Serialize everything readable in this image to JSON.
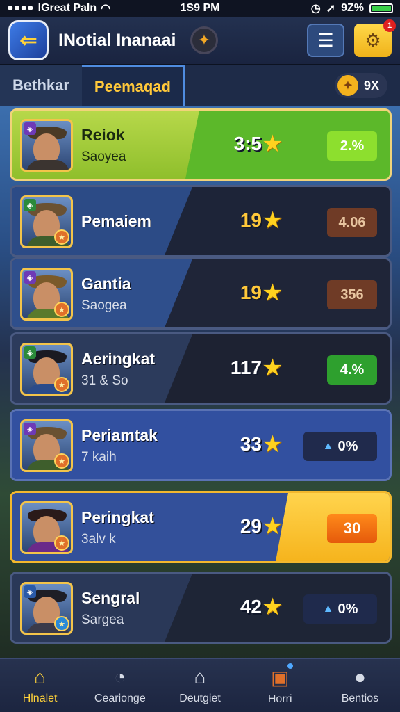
{
  "status_bar": {
    "left_text": "IGreat Paln",
    "time": "1S9 PM",
    "battery": "9Z%",
    "battery_level": 0.92
  },
  "header": {
    "title": "INotial Inanaai"
  },
  "tabs": [
    {
      "label": "Bethkar"
    },
    {
      "label": "Peemaqad"
    }
  ],
  "currency": {
    "label": "9X"
  },
  "leaderboard": [
    {
      "name": "Reiok",
      "sub": "Saoyea",
      "score": "3:5",
      "pct": "2.%"
    },
    {
      "name": "Pemaiem",
      "sub": "",
      "score": "19",
      "pct": "4.06"
    },
    {
      "name": "Gantia",
      "sub": "Saogea",
      "score": "19",
      "pct": "356"
    },
    {
      "name": "Aeringkat",
      "sub": "31 & So",
      "score": "117",
      "pct": "4.%"
    },
    {
      "name": "Periamtak",
      "sub": "7 kaih",
      "score": "33",
      "pct": "0%"
    },
    {
      "name": "Peringkat",
      "sub": "3alv k",
      "score": "29",
      "pct": "30"
    },
    {
      "name": "Sengral",
      "sub": "Sargea",
      "score": "42",
      "pct": "0%"
    }
  ],
  "bottom_nav": [
    {
      "label": "Hlnalet",
      "icon": "home-icon"
    },
    {
      "label": "Cearionge",
      "icon": "stopwatch-icon"
    },
    {
      "label": "Deutgiet",
      "icon": "house-icon"
    },
    {
      "label": "Horri",
      "icon": "ticket-icon"
    },
    {
      "label": "Bentios",
      "icon": "profile-icon"
    }
  ]
}
